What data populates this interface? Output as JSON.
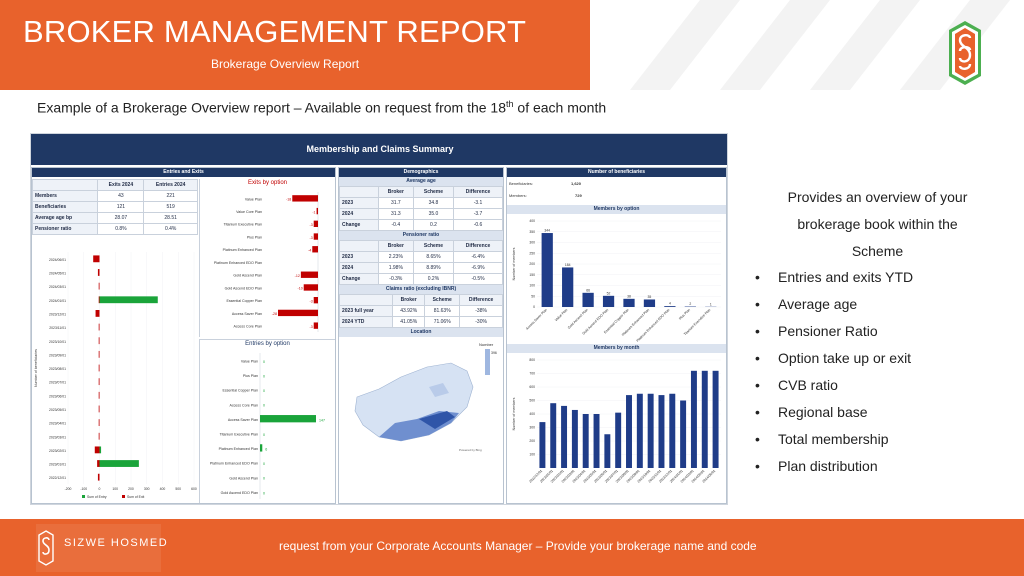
{
  "header": {
    "title": "BROKER MANAGEMENT REPORT",
    "subtitle": "Brokerage Overview Report"
  },
  "intro": {
    "text_before": "Example of a Brokerage Overview report – Available on request from the 18",
    "sup": "th",
    "text_after": " of each month"
  },
  "report": {
    "banner": "Membership and Claims Summary",
    "entries_exits": {
      "title": "Entries and Exits",
      "columns": [
        "",
        "Exits 2024",
        "Entries 2024"
      ],
      "rows": [
        [
          "Members",
          "43",
          "221"
        ],
        [
          "Beneficiaries",
          "121",
          "519"
        ],
        [
          "Average age bp",
          "28.07",
          "28.51"
        ],
        [
          "Pensioner ratio",
          "0.8%",
          "0.4%"
        ]
      ]
    },
    "exits_by_option": {
      "title": "Exits by option",
      "categories": [
        "Value Plan",
        "Value Core Plan",
        "Titanium Executive Plan",
        "Plus Plan",
        "Platinum Enhanced Plan",
        "Platinum Enhanced EDO Plan",
        "Gold Ascend Plan",
        "Gold Ascend EDO Plan",
        "Essential Copper Plan",
        "Access Saver Plan",
        "Access Core Plan"
      ],
      "values": [
        -18,
        -1,
        -3,
        -3,
        -4,
        0,
        -12,
        -10,
        -3,
        -28,
        -3
      ],
      "labels": [
        "-18",
        "-1",
        "-3",
        "-3",
        "-4",
        "",
        "-12",
        "-10",
        "-3",
        "-28",
        "-3"
      ]
    },
    "entries_by_option": {
      "title": "Entries by option",
      "categories": [
        "Value Plan",
        "Plus Plan",
        "Essential Copper Plan",
        "Access Core Plan",
        "Access Saver Plan",
        "Titanium Executive Plan",
        "Platinum Enhanced Plan",
        "Platinum Enhanced EDO Plan",
        "Gold Ascend Plan",
        "Gold Ascend EDO Plan"
      ],
      "values": [
        0,
        0,
        0,
        0,
        147,
        0,
        6,
        0,
        0,
        0
      ],
      "labels": [
        "0",
        "0",
        "0",
        "0",
        "147",
        "0",
        "6",
        "0",
        "0",
        "0"
      ]
    },
    "monthly": {
      "axis_label": "Number of beneficiaries",
      "months": [
        "2024/06/01",
        "2024/05/01",
        "2024/03/01",
        "2024/01/01",
        "2023/12/01",
        "2023/11/01",
        "2023/10/01",
        "2023/09/01",
        "2023/08/01",
        "2023/07/01",
        "2023/06/01",
        "2023/05/01",
        "2023/04/01",
        "2023/03/01",
        "2023/02/01",
        "2023/01/01",
        "2022/12/01"
      ],
      "exits": [
        -40,
        -10,
        -5,
        -5,
        -25,
        -5,
        -5,
        -5,
        -5,
        -5,
        -5,
        -5,
        -5,
        -5,
        -30,
        -15,
        -10
      ],
      "entries": [
        0,
        0,
        0,
        370,
        0,
        0,
        0,
        0,
        0,
        0,
        0,
        0,
        0,
        0,
        10,
        250,
        0
      ],
      "x_ticks": [
        "-200",
        "-100",
        "0",
        "100",
        "200",
        "300",
        "400",
        "500",
        "600"
      ],
      "legend": [
        "Sum of Entry",
        "Sum of Exit"
      ]
    },
    "demographics": {
      "title": "Demographics",
      "avg_age_title": "Average age",
      "avg_age_columns": [
        "",
        "Broker",
        "Scheme",
        "Difference"
      ],
      "avg_age_rows": [
        [
          "2023",
          "31.7",
          "34.8",
          "-3.1"
        ],
        [
          "2024",
          "31.3",
          "35.0",
          "-3.7"
        ],
        [
          "Change",
          "-0.4",
          "0.2",
          "-0.6"
        ]
      ],
      "pensioner_title": "Pensioner ratio",
      "pensioner_columns": [
        "",
        "Broker",
        "Scheme",
        "Difference"
      ],
      "pensioner_rows": [
        [
          "2023",
          "2.23%",
          "8.65%",
          "-6.4%"
        ],
        [
          "2024",
          "1.98%",
          "8.89%",
          "-6.9%"
        ],
        [
          "Change",
          "-0.3%",
          "0.2%",
          "-0.5%"
        ]
      ],
      "claims_title": "Claims ratio (excluding IBNR)",
      "claims_columns": [
        "",
        "Broker",
        "Scheme",
        "Difference"
      ],
      "claims_rows": [
        [
          "2023 full year",
          "43.92%",
          "81.63%",
          "-38%"
        ],
        [
          "2024 YTD",
          "41.05%",
          "71.06%",
          "-30%"
        ]
      ],
      "location_title": "Location",
      "location_legend": "Number",
      "location_min": "396",
      "location_note": "Powered by Bing"
    },
    "beneficiaries": {
      "title": "Number of beneficiaries",
      "beneficiaries_label": "Beneficiaries:",
      "beneficiaries_value": "1,620",
      "members_label": "Members:",
      "members_value": "729",
      "by_option_title": "Members by option",
      "by_option_axis": "Number of members",
      "by_option_categories": [
        "Access Saver Plan",
        "Value Plan",
        "Gold Ascend Plan",
        "Gold Ascend EDO Plan",
        "Essential Copper Plan",
        "Platinum Enhanced Plan",
        "Platinum Enhanced EDO Plan",
        "Plus Plan",
        "Titanium Executive Plan"
      ],
      "by_option_values": [
        344,
        184,
        66,
        52,
        38,
        35,
        4,
        2,
        1
      ],
      "by_option_ticks": [
        "400",
        "350",
        "300",
        "250",
        "200",
        "150",
        "100",
        "50",
        "0"
      ],
      "by_month_title": "Members by month",
      "by_month_axis": "Number of members",
      "by_month_values": [
        340,
        480,
        460,
        430,
        400,
        400,
        250,
        410,
        540,
        550,
        550,
        540,
        550,
        500,
        720,
        720,
        720
      ],
      "by_month_ticks": [
        "800",
        "700",
        "600",
        "500",
        "400",
        "300",
        "200",
        "100"
      ],
      "by_month_labels": [
        "2022/12/01",
        "2023/01/01",
        "2023/02/01",
        "2023/03/01",
        "2023/04/01",
        "2023/05/01",
        "2023/06/01",
        "2023/07/01",
        "2023/08/01",
        "2023/09/01",
        "2023/10/01",
        "2023/11/01",
        "2023/12/01",
        "2024/01/01",
        "2024/03/01",
        "2024/05/01",
        "2024/06/01"
      ]
    }
  },
  "right": {
    "heading_lines": [
      "Provides an overview of your",
      "brokerage book within the",
      "Scheme"
    ],
    "bullet_char": "•",
    "bullets": [
      "Entries and exits YTD",
      "Average age",
      "Pensioner Ratio",
      "Option take up or exit",
      "CVB ratio",
      "Regional base",
      "Total membership",
      "Plan distribution"
    ]
  },
  "footer": {
    "brand": "SIZWE HOSMED",
    "text": "request from your Corporate Accounts Manager – Provide your brokerage name and code"
  },
  "colors": {
    "accent": "#e8622c",
    "navy": "#1f3864",
    "bar_blue": "#1f3c88",
    "exit_red": "#c00000",
    "entry_green": "#1aa43a"
  }
}
